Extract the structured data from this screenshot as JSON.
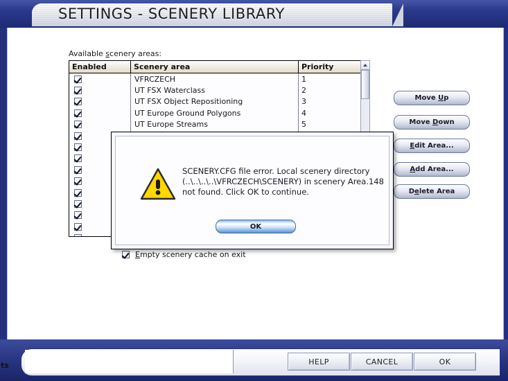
{
  "window": {
    "title": "SETTINGS - SCENERY LIBRARY",
    "corner_text": "ts"
  },
  "list": {
    "label": "Available scenery areas:",
    "columns": [
      "Enabled",
      "Scenery area",
      "Priority"
    ],
    "rows": [
      {
        "enabled": true,
        "name": "VFRCZECH",
        "priority": "1"
      },
      {
        "enabled": true,
        "name": "UT FSX Waterclass",
        "priority": "2"
      },
      {
        "enabled": true,
        "name": "UT FSX Object Repositioning",
        "priority": "3"
      },
      {
        "enabled": true,
        "name": "UT Europe Ground Polygons",
        "priority": "4"
      },
      {
        "enabled": true,
        "name": "UT Europe Streams",
        "priority": "5"
      },
      {
        "enabled": true,
        "name": "",
        "priority": ""
      },
      {
        "enabled": true,
        "name": "",
        "priority": ""
      },
      {
        "enabled": true,
        "name": "",
        "priority": ""
      },
      {
        "enabled": true,
        "name": "",
        "priority": ""
      },
      {
        "enabled": true,
        "name": "",
        "priority": ""
      },
      {
        "enabled": true,
        "name": "",
        "priority": ""
      },
      {
        "enabled": true,
        "name": "",
        "priority": ""
      },
      {
        "enabled": true,
        "name": "",
        "priority": ""
      },
      {
        "enabled": true,
        "name": "",
        "priority": ""
      },
      {
        "enabled": false,
        "name": "",
        "priority": ""
      }
    ],
    "scrollbar": {
      "up_arrow": "scroll-up-arrow"
    }
  },
  "options": {
    "empty_cache_label": "Empty scenery cache on exit",
    "empty_cache_checked": true
  },
  "side_buttons": [
    {
      "label": "Move Up",
      "accel": "U"
    },
    {
      "label": "Move Down",
      "accel": "D"
    },
    {
      "label": "Edit Area...",
      "accel": "E"
    },
    {
      "label": "Add Area...",
      "accel": "A"
    },
    {
      "label": "Delete Area",
      "accel": "e"
    }
  ],
  "bottom_buttons": [
    {
      "label": "HELP"
    },
    {
      "label": "CANCEL"
    },
    {
      "label": "OK"
    }
  ],
  "dialog": {
    "icon": "warning-triangle-icon",
    "message_line1": "SCENERY.CFG file error. Local scenery directory",
    "message_line2": "(..\\..\\..\\..\\VFRCZECH\\SCENERY) in scenery Area.148",
    "message_line3": "not found. Click OK to continue.",
    "ok_label": "OK"
  },
  "colors": {
    "frame_blue": "#24307e",
    "accent_blue": "#3c4b9c",
    "warning_yellow": "#ffd400",
    "panel_white": "#ffffff"
  }
}
